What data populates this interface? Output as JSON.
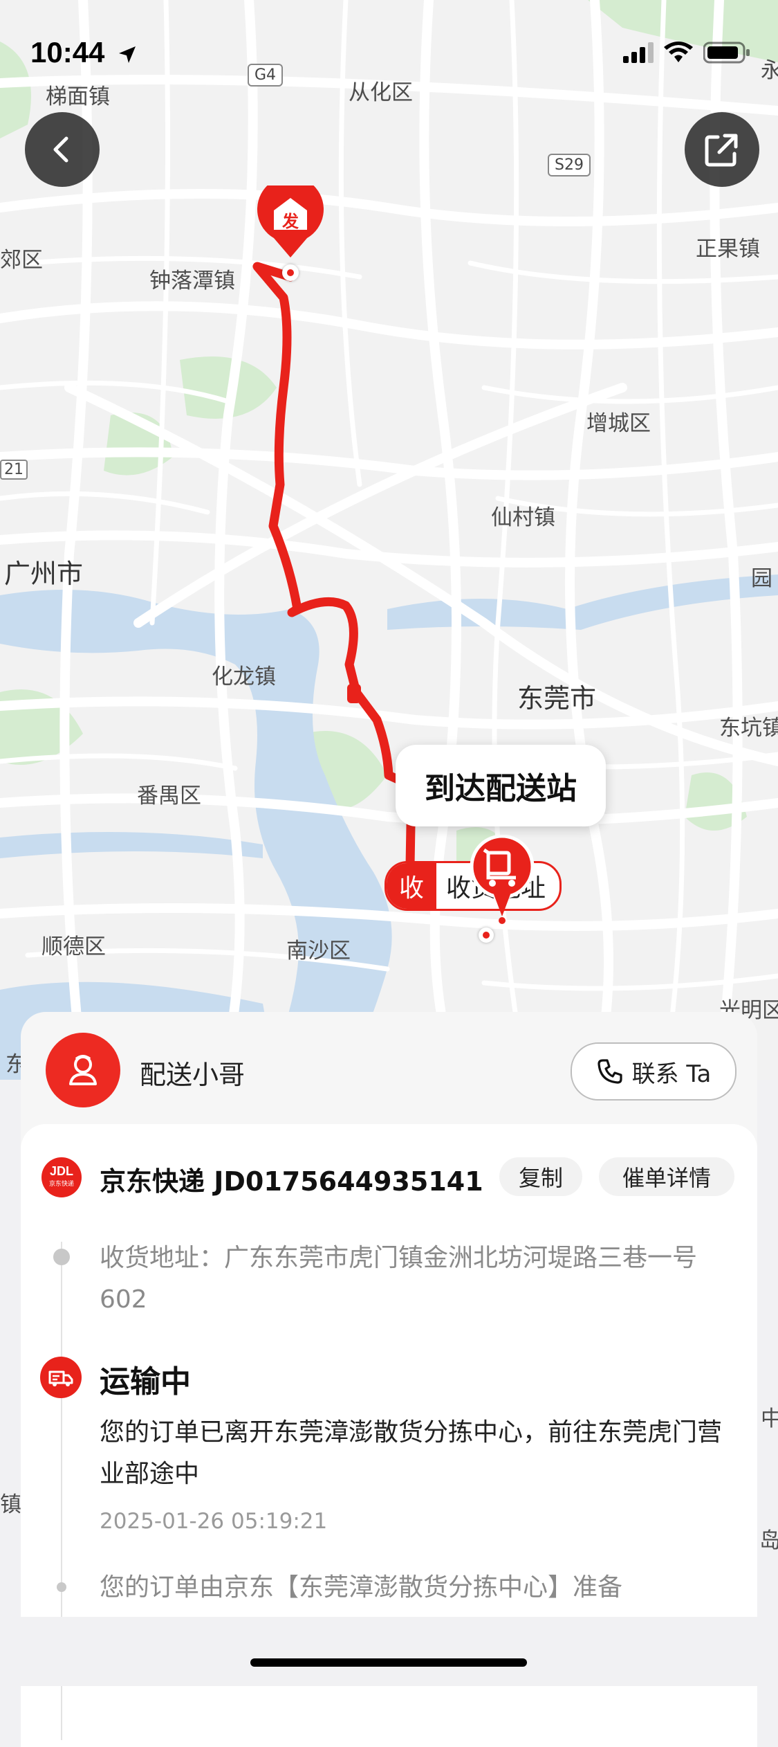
{
  "status_bar": {
    "time": "10:44"
  },
  "map_labels": [
    "梯面镇",
    "从化区",
    "钟落潭镇",
    "正果镇",
    "增城区",
    "仙村镇",
    "广州市",
    "东莞市",
    "化龙镇",
    "番禺区",
    "顺德区",
    "南沙区",
    "东坑镇",
    "光明区",
    "郊区",
    "园",
    "永",
    "东",
    "镇",
    "岛",
    "中",
    "21"
  ],
  "road_badges": [
    "G4",
    "S29"
  ],
  "map_markers": {
    "origin": "发",
    "destination_tag_left": "收",
    "destination_tag_right": "收货地址"
  },
  "map_bubble": "到达配送站",
  "courier": {
    "label": "配送小哥",
    "contact_button": "联系 Ta"
  },
  "shipment": {
    "logo_text": "JDL",
    "logo_sub": "京东快递",
    "carrier_line": "京东快递 JD0175644935141",
    "copy_button": "复制",
    "detail_button": "催单详情"
  },
  "timeline": {
    "address": "收货地址：广东东莞市虎门镇金洲北坊河堤路三巷一号602",
    "status_title": "运输中",
    "status_desc": "您的订单已离开东莞漳澎散货分拣中心，前往东莞虎门营业部途中",
    "status_time": "2025-01-26 05:19:21",
    "next_desc": "您的订单由京东【东莞漳澎散货分拣中心】准备"
  },
  "colors": {
    "accent": "#e8221b",
    "map_bg": "#f2f2f2",
    "water": "#c8dcef",
    "green": "#d5ecd0"
  },
  "icons": [
    "back-icon",
    "share-icon",
    "courier-avatar-icon",
    "phone-icon",
    "truck-icon",
    "cart-icon"
  ]
}
